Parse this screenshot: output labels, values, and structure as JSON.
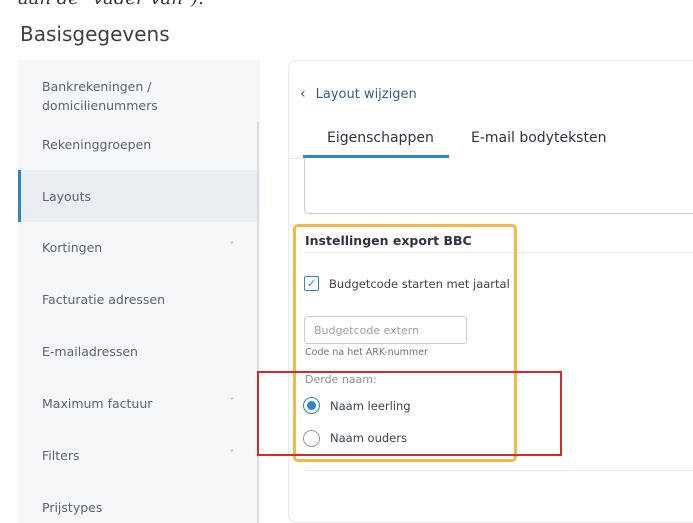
{
  "caption_fragment": "aan de \"vader van\").",
  "page_title": "Basisgegevens",
  "sidebar": {
    "items": [
      {
        "label": "Bankrekeningen / domicilienummers",
        "label_line1": "Bankrekeningen /",
        "label_line2": "domicilienummers",
        "active": false
      },
      {
        "label": "Rekeninggroepen",
        "active": false
      },
      {
        "label": "Layouts",
        "active": true
      },
      {
        "label": "Kortingen",
        "has_chevron": true,
        "active": false
      },
      {
        "label": "Facturatie adressen",
        "active": false
      },
      {
        "label": "E-mailadressen",
        "active": false
      },
      {
        "label": "Maximum factuur",
        "has_chevron": true,
        "active": false
      },
      {
        "label": "Filters",
        "has_chevron": true,
        "active": false
      },
      {
        "label": "Prijstypes",
        "active": false
      }
    ],
    "chevron_glyph": "ˇ"
  },
  "header": {
    "back_icon": "‹",
    "back_label": "Layout wijzigen"
  },
  "tabs": [
    {
      "label": "Eigenschappen",
      "active": true
    },
    {
      "label": "E-mail bodyteksten",
      "active": false
    }
  ],
  "export_section": {
    "title": "Instellingen export BBC",
    "checkbox": {
      "label": "Budgetcode starten met jaartal",
      "checked": true,
      "mark": "✓"
    },
    "budget_input": {
      "placeholder": "Budgetcode extern",
      "value": ""
    },
    "helper_text": "Code na het ARK-nummer",
    "radio_group": {
      "label": "Derde naam:",
      "options": [
        {
          "label": "Naam leerling",
          "selected": true
        },
        {
          "label": "Naam ouders",
          "selected": false
        }
      ]
    }
  },
  "colors": {
    "accent": "#2f86c5",
    "highlight_orange": "#f2b84a",
    "highlight_red": "#d42a2a"
  }
}
